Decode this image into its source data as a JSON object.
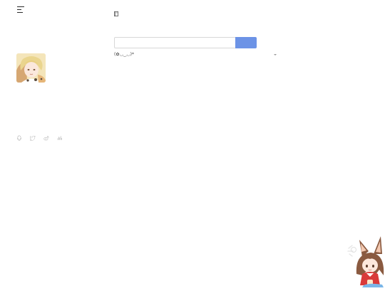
{
  "sidebar": {
    "site_name": "",
    "site_description": "",
    "social_links": [
      {
        "icon": "qq-icon"
      },
      {
        "icon": "twitter-icon"
      },
      {
        "icon": "weibo-icon"
      },
      {
        "icon": "netease-music-icon"
      }
    ]
  },
  "header": {
    "menu_icon": "menu-icon"
  },
  "main": {
    "page_title": "",
    "prompt_text": "",
    "input": {
      "value": "",
      "placeholder": ""
    },
    "submit_label": "",
    "select": {
      "selected": "(✿◡‿◡)*"
    },
    "info_lines": [
      "",
      "",
      ""
    ]
  },
  "colors": {
    "accent": "#6c93e6"
  }
}
